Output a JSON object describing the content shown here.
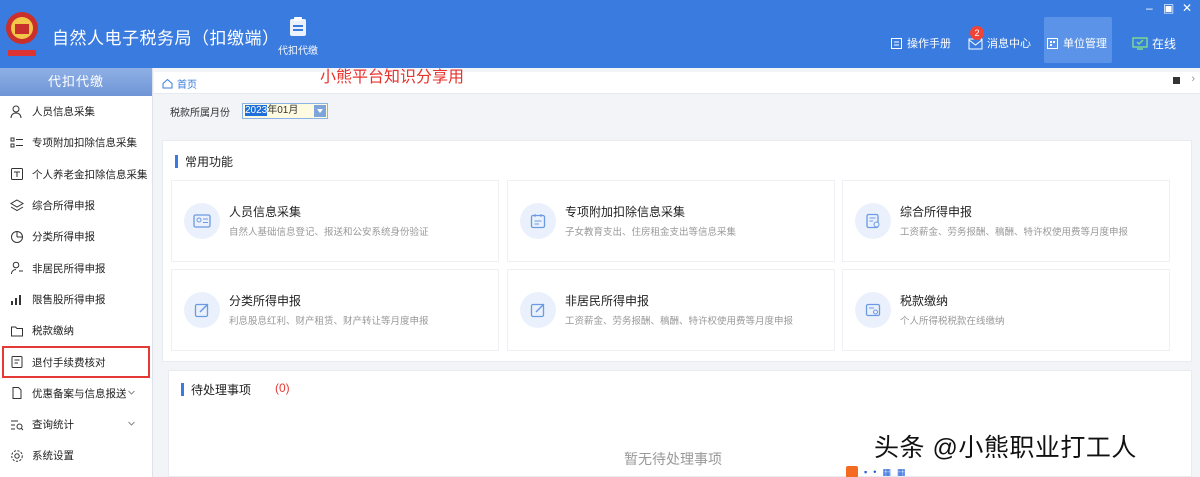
{
  "app": {
    "title": "自然人电子税务局（扣缴端）",
    "module_label": "代扣代缴"
  },
  "toolbar": {
    "manual_label": "操作手册",
    "messages_label": "消息中心",
    "messages_badge": "2",
    "unit_label": "单位管理",
    "online_label": "在线"
  },
  "sidebar": {
    "header": "代扣代缴",
    "items": [
      {
        "label": "人员信息采集",
        "icon": "person-icon"
      },
      {
        "label": "专项附加扣除信息采集",
        "icon": "list-icon"
      },
      {
        "label": "个人养老金扣除信息采集",
        "icon": "pension-icon"
      },
      {
        "label": "综合所得申报",
        "icon": "layers-icon"
      },
      {
        "label": "分类所得申报",
        "icon": "pie-icon"
      },
      {
        "label": "非居民所得申报",
        "icon": "user-outline-icon"
      },
      {
        "label": "限售股所得申报",
        "icon": "bar-chart-icon"
      },
      {
        "label": "税款缴纳",
        "icon": "folder-icon"
      },
      {
        "label": "退付手续费核对",
        "icon": "receipt-icon"
      },
      {
        "label": "优惠备案与信息报送",
        "icon": "document-icon"
      },
      {
        "label": "查询统计",
        "icon": "search-list-icon"
      },
      {
        "label": "系统设置",
        "icon": "gear-icon"
      }
    ]
  },
  "breadcrumb": {
    "home": "首页"
  },
  "watermark_top": "小熊平台知识分享用",
  "filter": {
    "label": "税款所属月份",
    "year": "2023",
    "month_suffix": "年01月"
  },
  "common": {
    "title": "常用功能",
    "cards": [
      {
        "title": "人员信息采集",
        "desc": "自然人基础信息登记、报送和公安系统身份验证",
        "icon": "id-card-icon"
      },
      {
        "title": "专项附加扣除信息采集",
        "desc": "子女教育支出、住房租金支出等信息采集",
        "icon": "calendar-doc-icon"
      },
      {
        "title": "综合所得申报",
        "desc": "工资薪金、劳务报酬、稿酬、特许权使用费等月度申报",
        "icon": "report-icon"
      },
      {
        "title": "分类所得申报",
        "desc": "利息股息红利、财产租赁、财产转让等月度申报",
        "icon": "edit-icon"
      },
      {
        "title": "非居民所得申报",
        "desc": "工资薪金、劳务报酬、稿酬、特许权使用费等月度申报",
        "icon": "edit-icon"
      },
      {
        "title": "税款缴纳",
        "desc": "个人所得税税款在线缴纳",
        "icon": "payment-icon"
      }
    ]
  },
  "pending": {
    "title": "待处理事项",
    "count": "(0)",
    "empty": "暂无待处理事项"
  },
  "watermark_bottom": "头条 @小熊职业打工人",
  "colors": {
    "primary": "#3a7be0",
    "highlight_red": "#e53935"
  }
}
